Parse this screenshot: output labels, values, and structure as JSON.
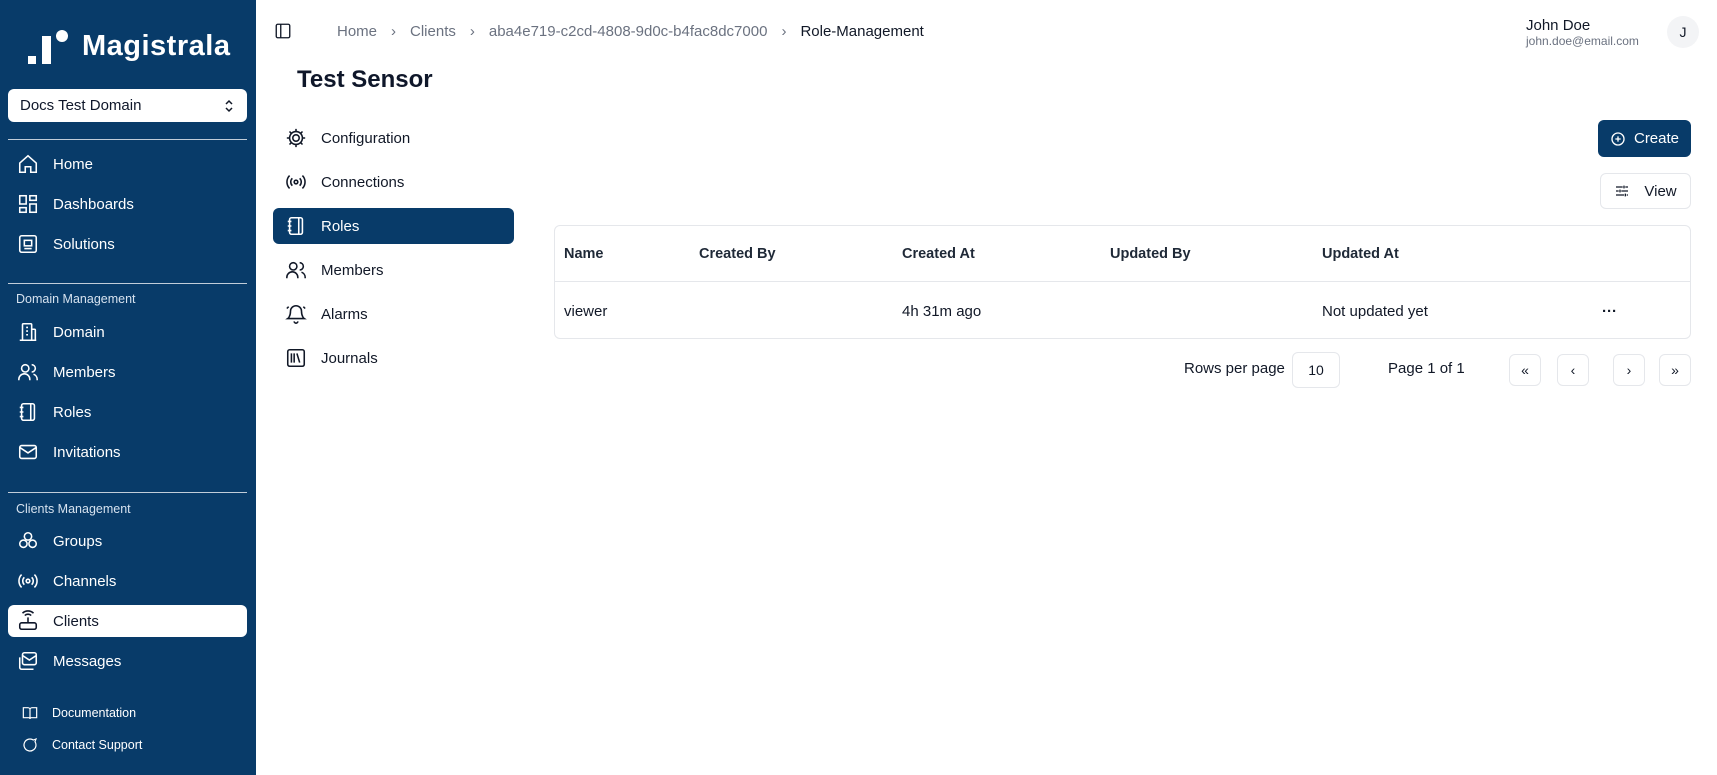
{
  "brand": {
    "name": "Magistrala"
  },
  "domain_select": {
    "value": "Docs Test Domain"
  },
  "sidebar": {
    "main": [
      {
        "label": "Home",
        "icon": "home-icon"
      },
      {
        "label": "Dashboards",
        "icon": "dashboard-icon"
      },
      {
        "label": "Solutions",
        "icon": "solutions-icon"
      }
    ],
    "domain_group": {
      "label": "Domain Management",
      "items": [
        {
          "label": "Domain",
          "icon": "building-icon"
        },
        {
          "label": "Members",
          "icon": "users-icon"
        },
        {
          "label": "Roles",
          "icon": "notebook-icon"
        },
        {
          "label": "Invitations",
          "icon": "mail-icon"
        }
      ]
    },
    "clients_group": {
      "label": "Clients Management",
      "items": [
        {
          "label": "Groups",
          "icon": "groups-icon"
        },
        {
          "label": "Channels",
          "icon": "broadcast-icon"
        },
        {
          "label": "Clients",
          "icon": "router-icon",
          "active": true
        },
        {
          "label": "Messages",
          "icon": "messages-icon"
        }
      ]
    },
    "footer": [
      {
        "label": "Documentation",
        "icon": "book-icon"
      },
      {
        "label": "Contact Support",
        "icon": "chat-icon"
      }
    ]
  },
  "breadcrumb": [
    "Home",
    "Clients",
    "aba4e719-c2cd-4808-9d0c-b4fac8dc7000",
    "Role-Management"
  ],
  "user": {
    "name": "John Doe",
    "email": "john.doe@email.com",
    "initial": "J"
  },
  "page_title": "Test Sensor",
  "subnav": [
    {
      "label": "Configuration",
      "icon": "settings-icon"
    },
    {
      "label": "Connections",
      "icon": "broadcast-icon"
    },
    {
      "label": "Roles",
      "icon": "notebook-icon",
      "active": true
    },
    {
      "label": "Members",
      "icon": "users-icon"
    },
    {
      "label": "Alarms",
      "icon": "bell-icon"
    },
    {
      "label": "Journals",
      "icon": "library-icon"
    }
  ],
  "actions": {
    "create_label": "Create",
    "view_label": "View"
  },
  "table": {
    "columns": [
      "Name",
      "Created By",
      "Created At",
      "Updated By",
      "Updated At"
    ],
    "rows": [
      {
        "name": "viewer",
        "created_by": "",
        "created_at": "4h 31m ago",
        "updated_by": "",
        "updated_at": "Not updated yet",
        "actions": "···"
      }
    ]
  },
  "pagination": {
    "rows_per_page_label": "Rows per page",
    "rows_per_page": "10",
    "page_info": "Page 1 of 1",
    "first": "«",
    "prev": "‹",
    "next": "›",
    "last": "»"
  },
  "colors": {
    "primary": "#083b69",
    "border": "#e5e7eb"
  }
}
